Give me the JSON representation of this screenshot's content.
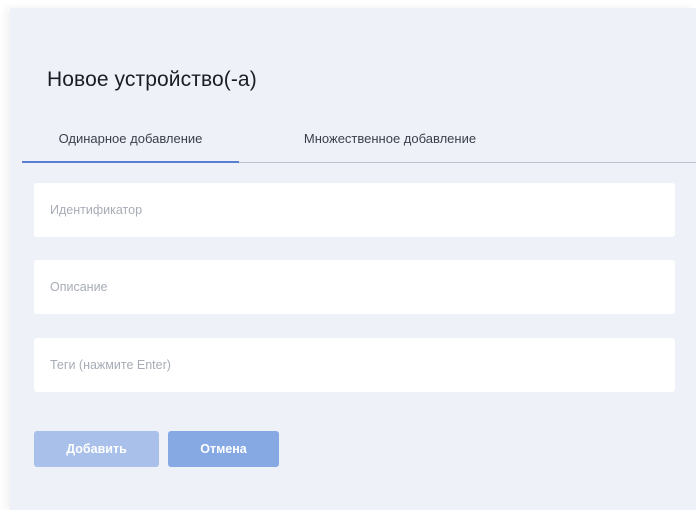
{
  "dialog": {
    "title": "Новое устройство(-а)"
  },
  "tabs": [
    {
      "label": "Одинарное добавление",
      "active": true
    },
    {
      "label": "Множественное добавление",
      "active": false
    }
  ],
  "form": {
    "identifier_placeholder": "Идентификатор",
    "identifier_value": "",
    "description_placeholder": "Описание",
    "description_value": "",
    "tags_placeholder": "Теги (нажмите Enter)",
    "tags_value": ""
  },
  "actions": {
    "add_label": "Добавить",
    "add_disabled": true,
    "cancel_label": "Отмена"
  },
  "colors": {
    "dialog_background": "#eef1f8",
    "accent": "#5a7fd1",
    "add_button": "#a9c0ea",
    "cancel_button": "#86a9e4"
  }
}
